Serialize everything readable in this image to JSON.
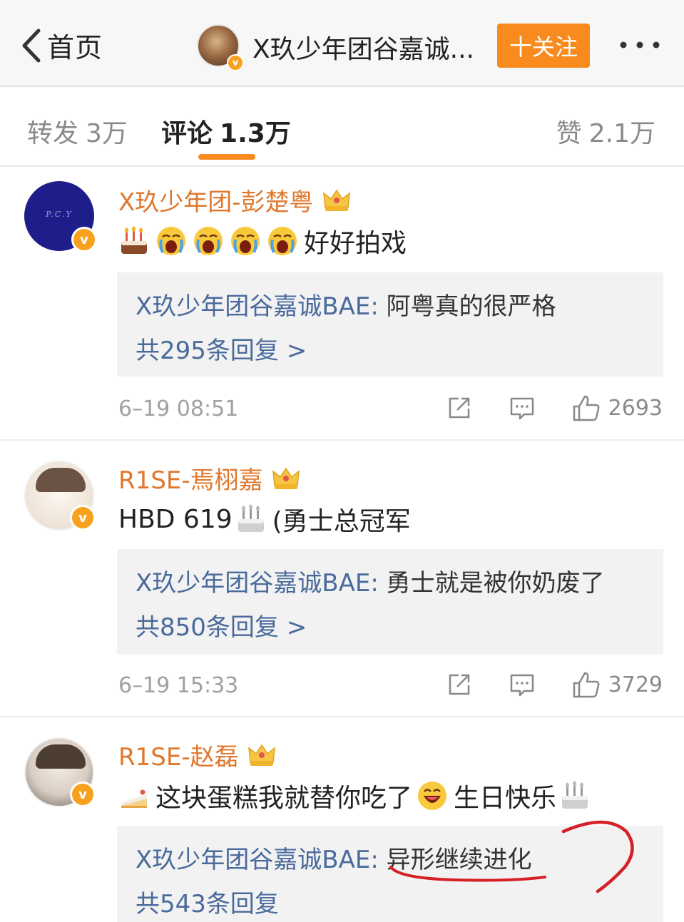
{
  "header": {
    "back_label": "首页",
    "title": "X玖少年团谷嘉诚...",
    "follow_label": "十关注"
  },
  "tabs": {
    "repost": {
      "label": "转发",
      "count": "3万"
    },
    "comment": {
      "label": "评论",
      "count": "1.3万"
    },
    "like": {
      "label": "赞",
      "count": "2.1万"
    },
    "active": "comment"
  },
  "comments": [
    {
      "username": "X玖少年团-彭楚粤",
      "avatar_text": "P.C.Y",
      "content_emojis": [
        "cake",
        "cry",
        "cry",
        "cry",
        "cry"
      ],
      "content": "好好拍戏",
      "reply_author": "X玖少年团谷嘉诚BAE:",
      "reply_text": "阿粤真的很严格",
      "reply_count": "共295条回复 >",
      "time": "6–19 08:51",
      "likes": "2693"
    },
    {
      "username": "R1SE-焉栩嘉",
      "content_prefix": "HBD 619",
      "content_emojis": [
        "cake"
      ],
      "content": " (勇士总冠军",
      "reply_author": "X玖少年团谷嘉诚BAE:",
      "reply_text": "勇士就是被你奶废了",
      "reply_count": "共850条回复 >",
      "time": "6–19 15:33",
      "likes": "3729"
    },
    {
      "username": "R1SE-赵磊",
      "content_lead_emoji": "cake-slice",
      "content": "这块蛋糕我就替你吃了",
      "content_mid_emoji": "laugh",
      "content_tail": "生日快乐",
      "content_end_emoji": "cake",
      "reply_author": "X玖少年团谷嘉诚BAE:",
      "reply_text": "异形继续进化",
      "reply_count": "共543条回复"
    }
  ],
  "icons": [
    "chevron-left-icon",
    "more-icon",
    "share-icon",
    "comment-icon",
    "like-icon",
    "crown-icon",
    "verified-icon"
  ],
  "colors": {
    "accent": "#f98a1e",
    "username": "#e0772d",
    "reply_link": "#4a6a9c",
    "annotation": "#d61f26"
  }
}
